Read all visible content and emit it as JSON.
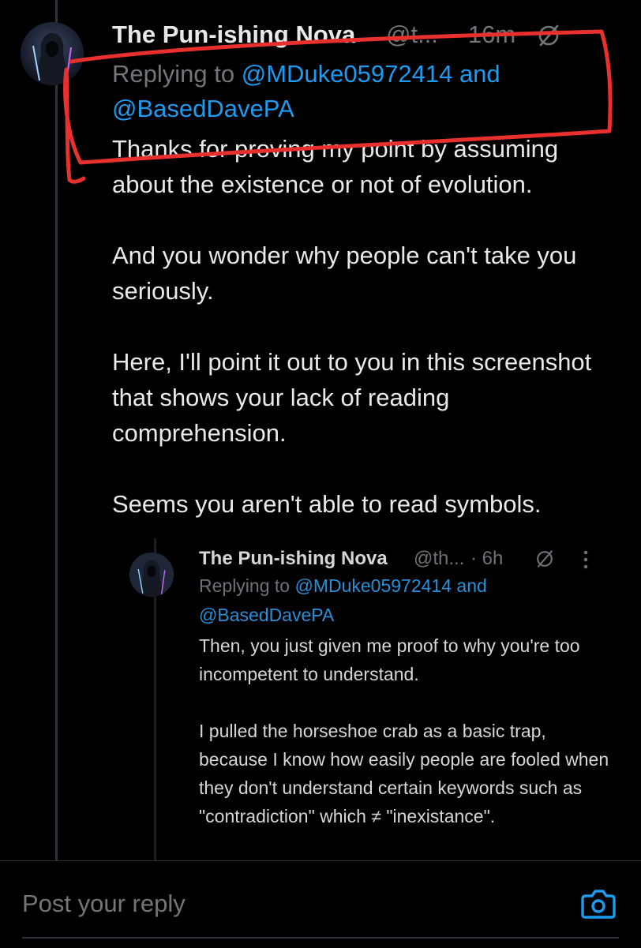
{
  "tweet": {
    "author_name": "The Pun-ishing Nova",
    "handle": "@t...",
    "time": "· 16m",
    "replying_prefix": "Replying to",
    "mention_1": "@MDuke05972414",
    "replying_and": "and",
    "mention_2": "@BasedDavePA",
    "paragraphs": [
      "Thanks for proving my point by assuming about the existence or not of evolution.",
      "And you wonder why people can't take you seriously.",
      "Here, I'll point it out to you in this screenshot that shows your lack of reading comprehension.",
      "Seems you aren't able to read symbols."
    ]
  },
  "quoted_screenshot": {
    "author_name": "The Pun-ishing Nova",
    "handle": "@th...",
    "time": "· 6h",
    "replying_prefix": "Replying to",
    "mention_1": "@MDuke05972414",
    "replying_and": "and",
    "mention_2": "@BasedDavePA",
    "paragraphs": [
      "Then, you just given me proof to why you're too incompetent to understand.",
      "I pulled the horseshoe crab as a basic trap, because I know how easily people are fooled when they don't understand certain keywords such as \"contradiction\" which ≠ \"inexistance\"."
    ]
  },
  "reply_bar": {
    "placeholder": "Post your reply"
  },
  "colors": {
    "background": "#000000",
    "text": "#e7e9ea",
    "muted": "#71767b",
    "mention": "#1d9bf0",
    "annotation": "#e8302f"
  },
  "icons": {
    "grok": "grok-slash-icon",
    "more": "more-options-icon",
    "camera": "camera-icon"
  }
}
